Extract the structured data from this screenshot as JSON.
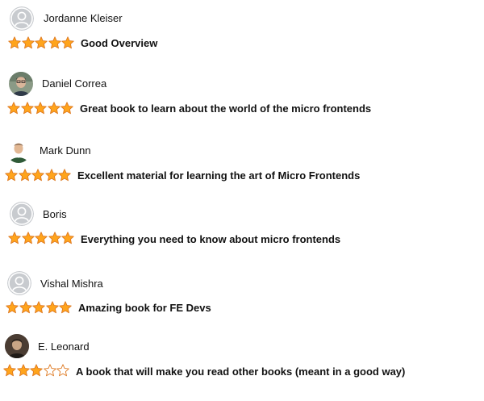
{
  "colors": {
    "star_fill": "#ffa41c",
    "star_stroke": "#de7921",
    "text": "#111111",
    "avatar_bg": "#c8cbcf"
  },
  "reviews": [
    {
      "avatar_icon": "default-user-icon",
      "name": "Jordanne Kleiser",
      "rating": 5,
      "max_rating": 5,
      "title": "Good Overview"
    },
    {
      "avatar_icon": "user-photo",
      "name": "Daniel Correa",
      "rating": 5,
      "max_rating": 5,
      "title": "Great book to learn about the world of the micro frontends"
    },
    {
      "avatar_icon": "user-photo",
      "name": "Mark Dunn",
      "rating": 5,
      "max_rating": 5,
      "title": "Excellent material for learning the art of Micro Frontends"
    },
    {
      "avatar_icon": "default-user-icon",
      "name": "Boris",
      "rating": 5,
      "max_rating": 5,
      "title": "Everything you need to know about micro frontends"
    },
    {
      "avatar_icon": "default-user-icon",
      "name": "Vishal Mishra",
      "rating": 5,
      "max_rating": 5,
      "title": "Amazing book for FE Devs"
    },
    {
      "avatar_icon": "user-photo",
      "name": "E. Leonard",
      "rating": 3,
      "max_rating": 5,
      "title": "A book that will make you read other books (meant in a good way)"
    }
  ]
}
